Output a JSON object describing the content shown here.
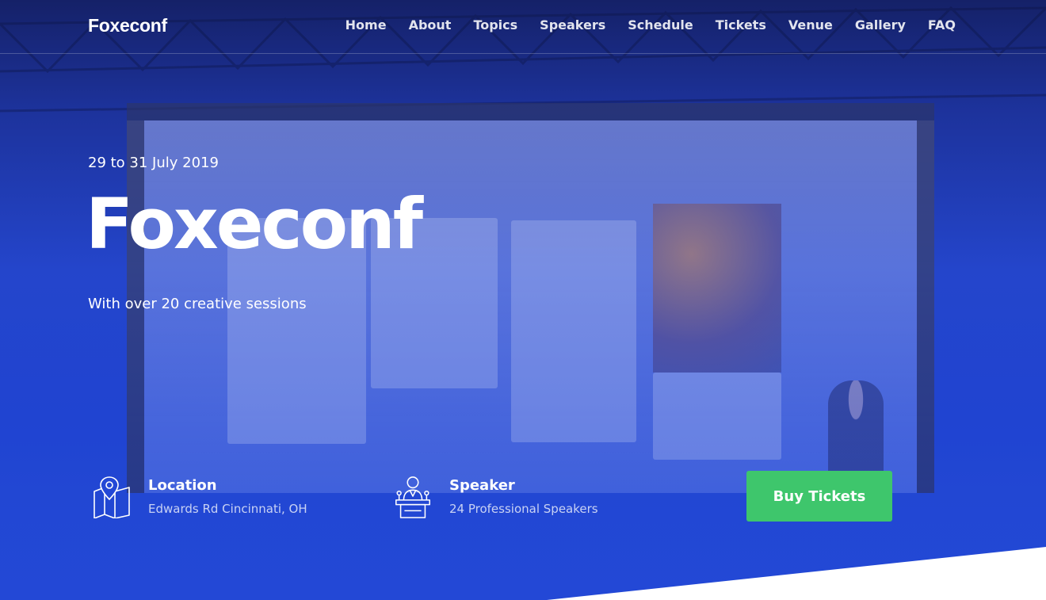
{
  "brand": {
    "name": "Foxeconf"
  },
  "nav": {
    "items": [
      "Home",
      "About",
      "Topics",
      "Speakers",
      "Schedule",
      "Tickets",
      "Venue",
      "Gallery",
      "FAQ"
    ]
  },
  "hero": {
    "date": "29 to 31 July 2019",
    "title": "Foxeconf",
    "subtitle": "With over 20 creative sessions"
  },
  "info": {
    "location": {
      "icon": "map-pin-icon",
      "label": "Location",
      "value": "Edwards Rd Cincinnati, OH"
    },
    "speaker": {
      "icon": "speaker-podium-icon",
      "label": "Speaker",
      "value": "24 Professional Speakers"
    }
  },
  "cta": {
    "label": "Buy Tickets",
    "color": "#3ec66c"
  },
  "colors": {
    "accent": "#2348d6",
    "white": "#ffffff"
  }
}
